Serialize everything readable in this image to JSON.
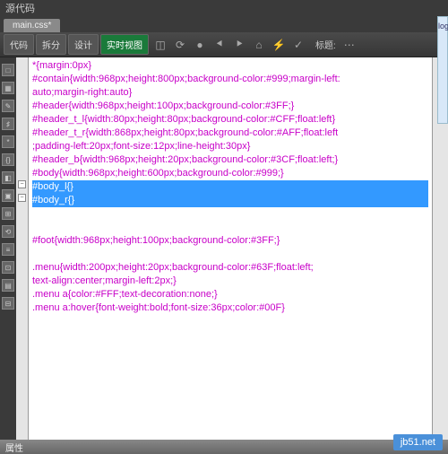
{
  "menubar": {
    "source": "源代码"
  },
  "tabs": {
    "main": "main.css*"
  },
  "toolbar": {
    "code": "代码",
    "split": "拆分",
    "design": "设计",
    "live": "实时视图",
    "title_label": "标题:"
  },
  "folds": {
    "minus1": "−",
    "minus2": "−"
  },
  "code": {
    "l1": {
      "sel": "*",
      "body": "{margin:0px}"
    },
    "l2": {
      "sel": "#contain",
      "body": "{width:968px;height:800px;background-color:#999;margin-left:"
    },
    "l3": {
      "body": "auto;margin-right:auto}"
    },
    "l4": {
      "sel": "#header",
      "body": "{width:968px;height:100px;background-color:#3FF;}"
    },
    "l5": {
      "sel": "#header_t_l",
      "body": "{width:80px;height:80px;background-color:#CFF;float:left}"
    },
    "l6": {
      "sel": "#header_t_r",
      "body": "{width:868px;height:80px;background-color:#AFF;float:left"
    },
    "l7": {
      "body": ";padding-left:20px;font-size:12px;line-height:30px}"
    },
    "l8": {
      "sel": "#header_b",
      "body": "{width:968px;height:20px;background-color:#3CF;float:left;}"
    },
    "l9": {
      "sel": "#body",
      "body": "{width:968px;height:600px;background-color:#999;}"
    },
    "l10": {
      "sel": "#body_l",
      "body": "{}"
    },
    "l11": {
      "sel": "#body_r",
      "body": "{}"
    },
    "l12": {
      "sel": "#foot",
      "body": "{width:968px;height:100px;background-color:#3FF;}"
    },
    "l13": {
      "sel": ".menu",
      "body": "{width:200px;height:20px;background-color:#63F;float:left;"
    },
    "l14": {
      "body": "text-align:center;margin-left:2px;}"
    },
    "l15": {
      "sel": ".menu a",
      "body": "{color:#FFF;text-decoration:none;}"
    },
    "l16": {
      "sel": ".menu a:hover",
      "body": "{font-weight:bold;font-size:36px;color:#00F}"
    }
  },
  "props": {
    "label": "属性"
  },
  "watermark": "jb51.net",
  "sidetext": "log"
}
